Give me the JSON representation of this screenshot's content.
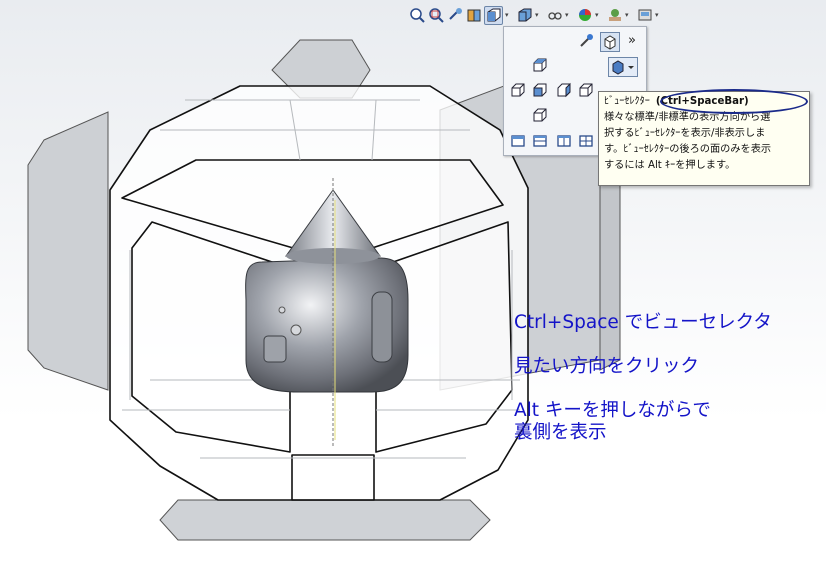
{
  "toolbar": {
    "icons": [
      "zoom-to-fit-icon",
      "zoom-to-area-icon",
      "previous-view-icon",
      "section-view-icon",
      "view-orientation-icon",
      "display-style-icon",
      "hide-show-items-icon",
      "edit-appearance-icon",
      "apply-scene-icon",
      "view-settings-icon"
    ]
  },
  "view_selector": {
    "more_label": "»",
    "icons": [
      "view-selector-toggle-icon",
      "view-selector-cube-icon",
      "top-view-icon",
      "left-view-icon",
      "front-view-icon",
      "right-view-icon",
      "back-view-icon",
      "bottom-view-icon",
      "isometric-view-icon",
      "single-view-icon",
      "two-view-horizontal-icon",
      "two-view-vertical-icon",
      "four-view-icon"
    ]
  },
  "tooltip": {
    "title": "ﾋﾞｭｰｾﾚｸﾀｰ",
    "shortcut": "(Ctrl+SpaceBar)",
    "lines": [
      "様々な標準/非標準の表示方向から選",
      "択するﾋﾞｭｰｾﾚｸﾀｰを表示/非表示しま",
      "す。ﾋﾞｭｰｾﾚｸﾀｰの後ろの面のみを表示",
      "するには Alt ｷｰを押します。"
    ]
  },
  "annotations": {
    "line1": "Ctrl+Space でビューセレクタ",
    "line2": "見たい方向をクリック",
    "line3": "Alt キーを押しながらで",
    "line4": "裏側を表示"
  },
  "colors": {
    "annotation_text": "#1414c8",
    "tooltip_background": "#fffff2",
    "highlight_oval": "#1a2a8a",
    "back_faces": "#cdd0d4"
  }
}
